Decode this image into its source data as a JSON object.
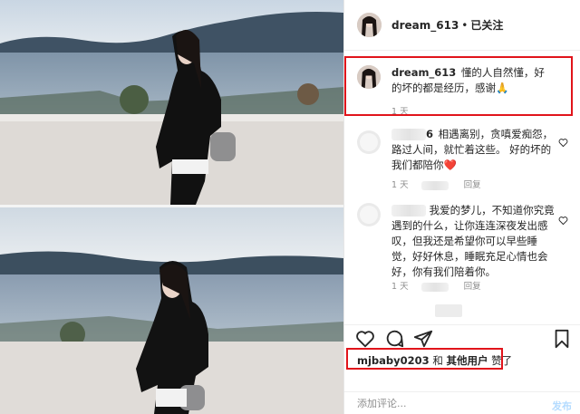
{
  "post": {
    "author": "dream_613",
    "separator": "•",
    "follow_status": "已关注"
  },
  "comments": [
    {
      "username": "dream_613",
      "text": "懂的人自然懂，好的坏的都是经历，感谢🙏",
      "time": "1 天",
      "highlighted": true
    },
    {
      "username_partial": "6",
      "text": "相遇离别，贪嗔爱痴怨，路过人间，就忙着这些。 好的坏的我们都陪你❤️",
      "time": "1 天",
      "likes": "35 赞",
      "reply": "回复",
      "heart_icon": "heart-outline-icon"
    },
    {
      "text": "我爱的梦儿，不知道你究竟遇到的什么，让你连连深夜发出感叹，但我还是希望你可以早些睡觉，好好休息，睡眠充足心情也会好，你有我们陪着你。",
      "time": "1 天",
      "likes": "50 赞",
      "reply": "回复",
      "heart_icon": "heart-outline-icon"
    }
  ],
  "actions": {
    "like_icon": "heart-outline-icon",
    "comment_icon": "comment-bubble-icon",
    "share_icon": "paper-plane-icon",
    "save_icon": "bookmark-icon"
  },
  "likes_line": {
    "user": "mjbaby0203",
    "conjunction": "和",
    "others": "其他用户",
    "suffix": "赞了"
  },
  "add_comment": {
    "placeholder": "添加评论...",
    "post_label": "发布"
  },
  "colors": {
    "highlight": "#e1141b",
    "text": "#262626",
    "secondary": "#8e8e8e",
    "post_disabled": "#b3dbff",
    "heart_red": "#ed4956"
  }
}
